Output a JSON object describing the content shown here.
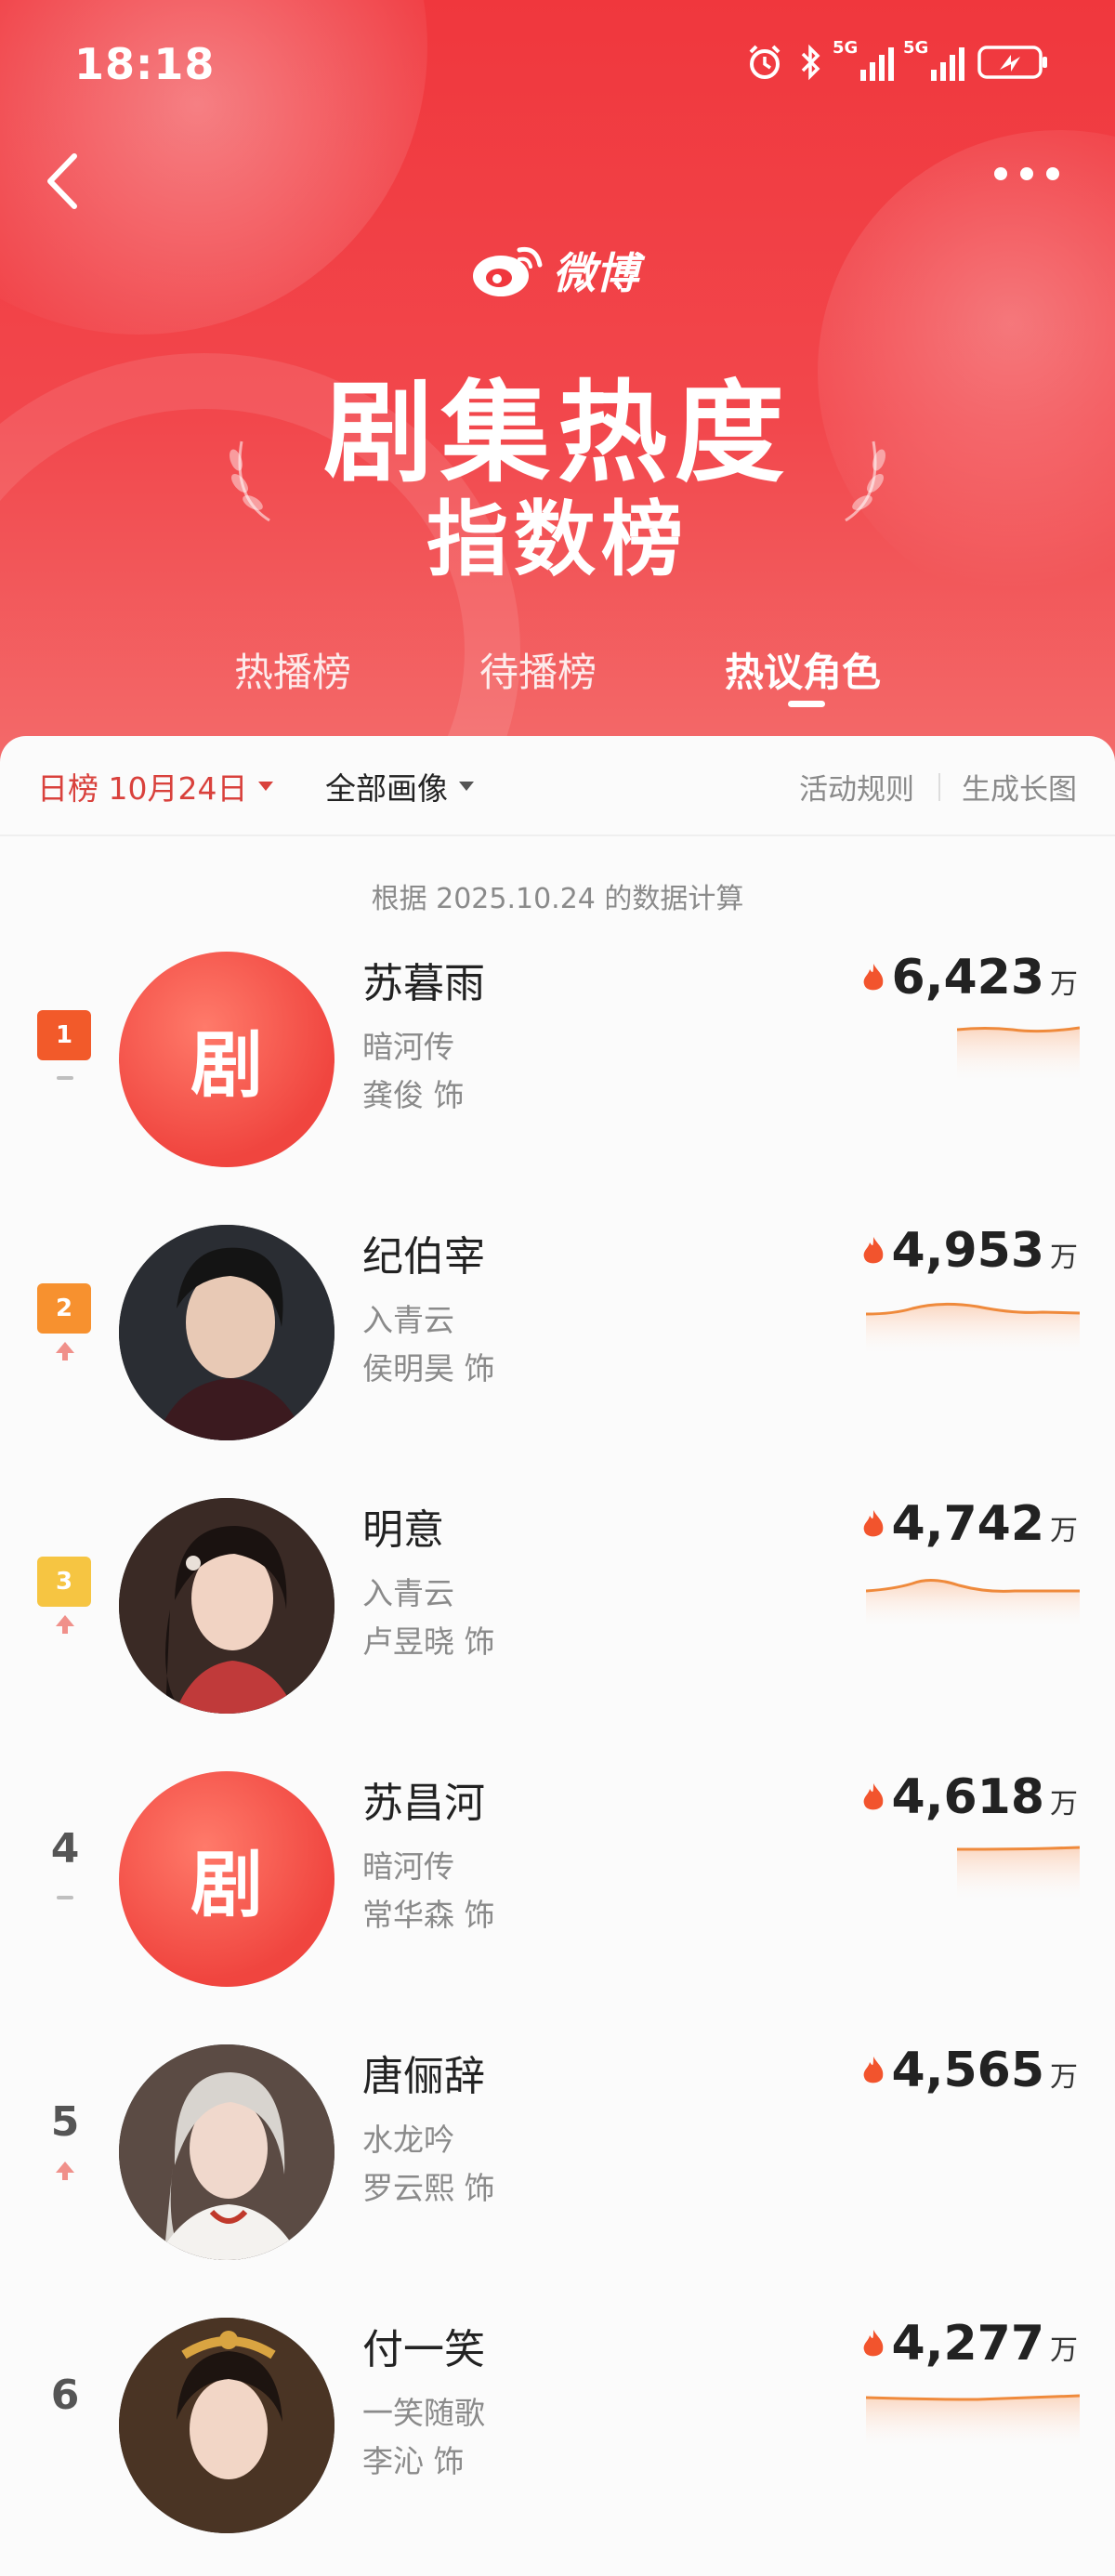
{
  "status_bar": {
    "time": "18:18",
    "signal1": "5G",
    "signal2": "5G"
  },
  "header": {
    "logo_text": "微博",
    "title_line1": "剧集热度",
    "title_line2": "指数榜",
    "tabs": [
      {
        "label": "热播榜",
        "active": false
      },
      {
        "label": "待播榜",
        "active": false
      },
      {
        "label": "热议角色",
        "active": true
      }
    ]
  },
  "filters": {
    "date_label": "日榜 10月24日",
    "type_label": "全部画像",
    "rules_link": "活动规则",
    "long_image_link": "生成长图"
  },
  "calc_note": "根据 2025.10.24 的数据计算",
  "rankings": [
    {
      "rank": "1",
      "trend": "flat",
      "avatar": "剧",
      "name": "苏暮雨",
      "drama": "暗河传",
      "actor": "龚俊 饰",
      "heat": "6,423",
      "unit": "万"
    },
    {
      "rank": "2",
      "trend": "up",
      "avatar": "",
      "name": "纪伯宰",
      "drama": "入青云",
      "actor": "侯明昊 饰",
      "heat": "4,953",
      "unit": "万"
    },
    {
      "rank": "3",
      "trend": "up",
      "avatar": "",
      "name": "明意",
      "drama": "入青云",
      "actor": "卢昱晓 饰",
      "heat": "4,742",
      "unit": "万"
    },
    {
      "rank": "4",
      "trend": "flat",
      "avatar": "剧",
      "name": "苏昌河",
      "drama": "暗河传",
      "actor": "常华森 饰",
      "heat": "4,618",
      "unit": "万"
    },
    {
      "rank": "5",
      "trend": "up",
      "avatar": "",
      "name": "唐俪辞",
      "drama": "水龙吟",
      "actor": "罗云熙 饰",
      "heat": "4,565",
      "unit": "万"
    },
    {
      "rank": "6",
      "trend": "",
      "avatar": "",
      "name": "付一笑",
      "drama": "一笑随歌",
      "actor": "李沁 饰",
      "heat": "4,277",
      "unit": "万"
    }
  ],
  "colors": {
    "brand_red": "#f0373d",
    "rank1": "#f25a2a",
    "rank2": "#f7912f",
    "rank3": "#f6c542",
    "flame": "#f2542d",
    "spark": "#ef8a3c"
  }
}
